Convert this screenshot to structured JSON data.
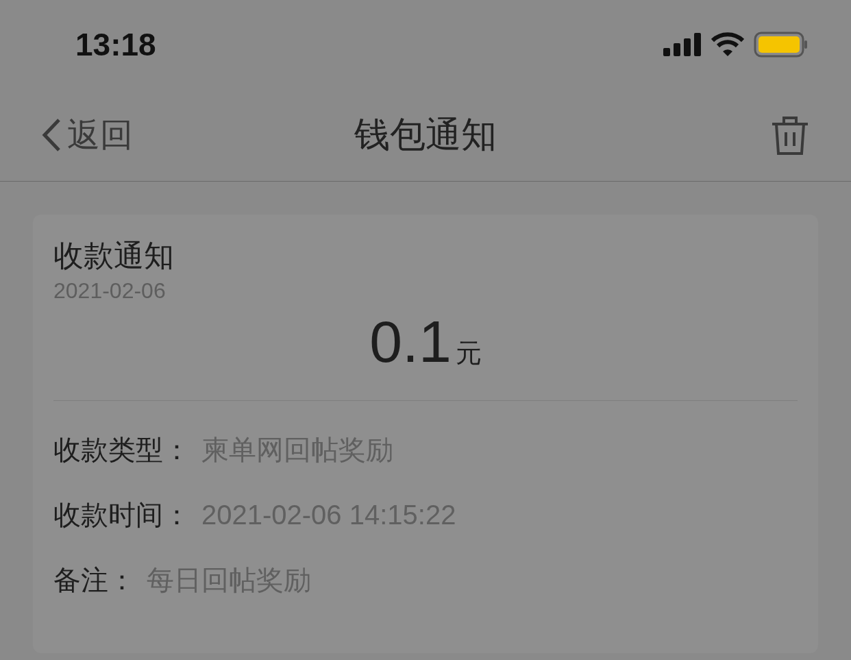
{
  "status_bar": {
    "time": "13:18"
  },
  "nav": {
    "back_label": "返回",
    "title": "钱包通知"
  },
  "card": {
    "title": "收款通知",
    "date": "2021-02-06",
    "amount": "0.1",
    "unit": "元",
    "fields": [
      {
        "label": "收款类型：",
        "value": "柬单网回帖奖励"
      },
      {
        "label": "收款时间：",
        "value": "2021-02-06 14:15:22"
      },
      {
        "label": "备注：",
        "value": "每日回帖奖励"
      }
    ]
  }
}
